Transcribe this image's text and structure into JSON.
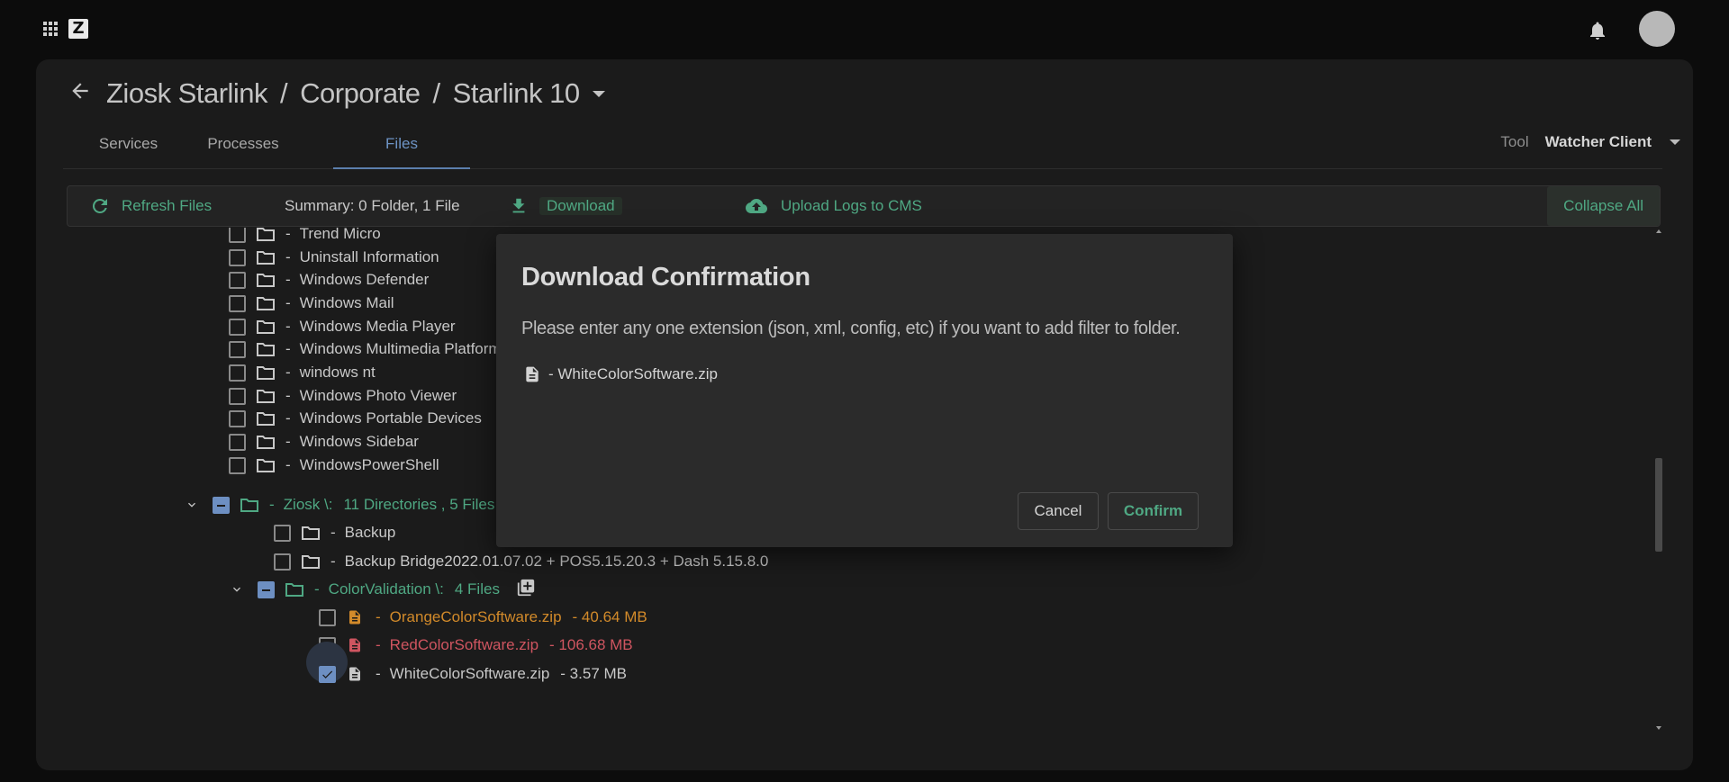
{
  "app": {
    "logo_letter": "Z"
  },
  "breadcrumb": {
    "parts": [
      "Ziosk Starlink",
      "Corporate",
      "Starlink 10"
    ],
    "separator": "/"
  },
  "tabs": [
    {
      "label": "Services",
      "active": false
    },
    {
      "label": "Processes",
      "active": false
    },
    {
      "label": "Files",
      "active": true
    }
  ],
  "tool": {
    "label": "Tool",
    "value": "Watcher Client"
  },
  "toolbar": {
    "refresh_label": "Refresh Files",
    "summary": "Summary: 0 Folder, 1 File",
    "download_label": "Download",
    "upload_label": "Upload Logs to CMS",
    "collapse_label": "Collapse All"
  },
  "tree": {
    "dash": "-",
    "folders": [
      "Trend Micro",
      "Uninstall Information",
      "Windows Defender",
      "Windows Mail",
      "Windows Media Player",
      "Windows Multimedia Platform",
      "windows nt",
      "Windows Photo Viewer",
      "Windows Portable Devices",
      "Windows Sidebar",
      "WindowsPowerShell"
    ],
    "ziosk": {
      "name": "Ziosk \\:",
      "meta": "11 Directories , 5 Files"
    },
    "ziosk_children": [
      "Backup",
      "Backup Bridge2022.01.07.02 + POS5.15.20.3 + Dash 5.15.8.0"
    ],
    "colorvalidation": {
      "name": "ColorValidation \\:",
      "meta": "4 Files"
    },
    "files": [
      {
        "name": "OrangeColorSoftware.zip",
        "size": "-  40.64 MB",
        "color": "#d28a2a",
        "checked": false
      },
      {
        "name": "RedColorSoftware.zip",
        "size": "-  106.68 MB",
        "color": "#cf5560",
        "checked": false
      },
      {
        "name": "WhiteColorSoftware.zip",
        "size": "-  3.57 MB",
        "color": "#c8c8c8",
        "checked": true
      }
    ]
  },
  "modal": {
    "title": "Download Confirmation",
    "message": "Please enter any one extension (json, xml, config, etc) if you want to add filter to folder.",
    "file": "- WhiteColorSoftware.zip",
    "cancel_label": "Cancel",
    "confirm_label": "Confirm"
  },
  "colors": {
    "accent_green": "#4fa883",
    "accent_blue": "#6d8fc2",
    "background": "#0c0c0c",
    "panel": "#1b1b1b"
  }
}
